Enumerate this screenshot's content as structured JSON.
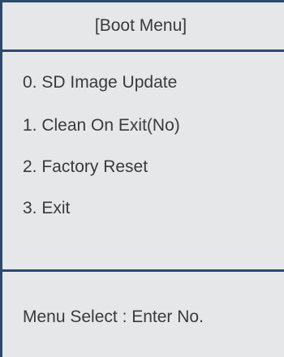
{
  "header": {
    "title": "[Boot Menu]"
  },
  "menu": {
    "items": [
      {
        "label": "0. SD Image Update"
      },
      {
        "label": "1. Clean On Exit(No)"
      },
      {
        "label": "2. Factory Reset"
      },
      {
        "label": "3. Exit"
      }
    ]
  },
  "footer": {
    "prompt": "Menu Select : Enter No."
  },
  "colors": {
    "background": "#e6e7e8",
    "border": "#2c4a6b",
    "text": "#3a3a3a"
  }
}
